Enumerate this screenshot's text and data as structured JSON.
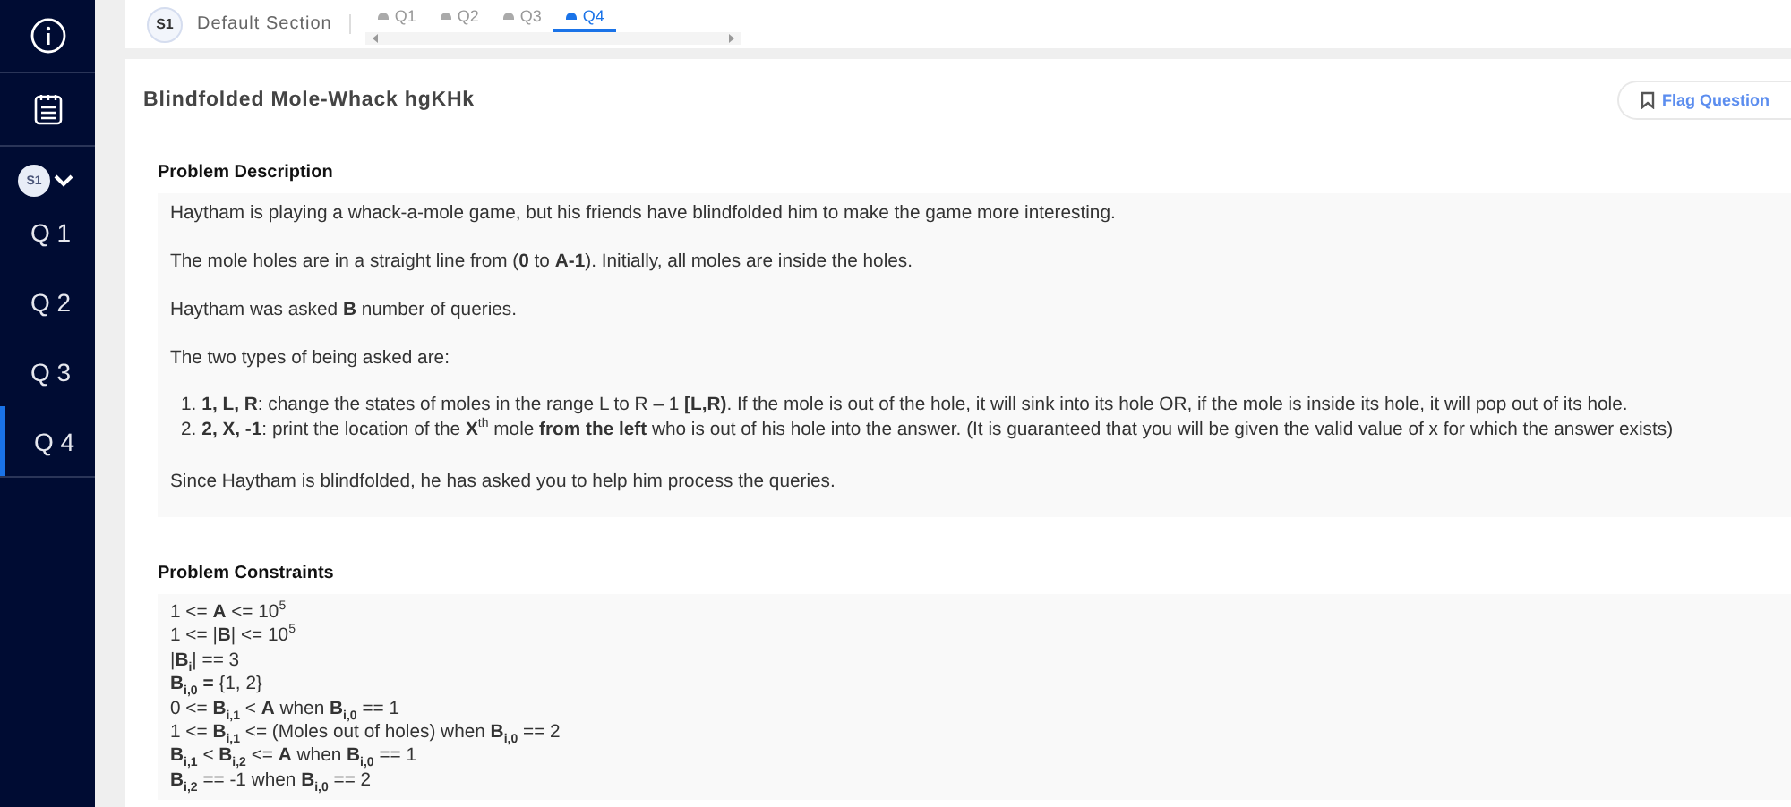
{
  "sidebar": {
    "section_badge": "S1",
    "expanded": true,
    "items": [
      {
        "label": "Q 1",
        "selected": false
      },
      {
        "label": "Q 2",
        "selected": false
      },
      {
        "label": "Q 3",
        "selected": false
      },
      {
        "label": "Q 4",
        "selected": true
      }
    ]
  },
  "header": {
    "section_badge": "S1",
    "section_name": "Default Section",
    "tabs": [
      {
        "label": "Q1",
        "selected": false
      },
      {
        "label": "Q2",
        "selected": false
      },
      {
        "label": "Q3",
        "selected": false
      },
      {
        "label": "Q4",
        "selected": true
      }
    ]
  },
  "question": {
    "title": "Blindfolded Mole-Whack hgKHk",
    "flag_button": "Flag Question",
    "description_heading": "Problem Description",
    "paragraphs": [
      "Haytham is playing a whack-a-mole game, but his friends have blindfolded him to make the game more interesting.",
      "The mole holes are in a straight line from (**0** to **A-1**). Initially, all moles are inside the holes.",
      "Haytham was asked **B** number of queries.",
      "The two types of being asked are:"
    ],
    "list": [
      {
        "marker": "1.",
        "text": "**1, L, R**: change the states of moles in the range L to R – 1 **[L,R)**. If the mole is out of the hole, it will sink into its hole OR, if the mole is inside its hole, it will pop out of its hole."
      },
      {
        "marker": "2.",
        "text": "**2, X, -1**: print the location of the **X**$^{th}$ mole **from the left** who is out of his hole into the answer. (It is guaranteed that you will be given the valid value of x for which the answer exists)"
      }
    ],
    "closing": "Since Haytham is blindfolded, he has asked you to help him process the queries.",
    "constraints_heading": "Problem Constraints",
    "constraints": [
      "1 <= **A** <= 10$^{5}$",
      "1 <= |**B**| <= 10$^{5}$",
      "|**B**$_{i}$| == 3",
      "**B**$_{i,0}$ **=** {1, 2}",
      "0 <= **B**$_{i,1}$ < **A** when **B**$_{i,0}$ == 1",
      "1 <= **B**$_{i,1}$ <= (Moles out of holes) when **B**$_{i,0}$ == 2",
      "**B**$_{i,1}$ < **B**$_{i,2}$ <= **A** when **B**$_{i,0}$ == 1",
      "**B**$_{i,2}$ == -1 when **B**$_{i,0}$ == 2"
    ]
  }
}
